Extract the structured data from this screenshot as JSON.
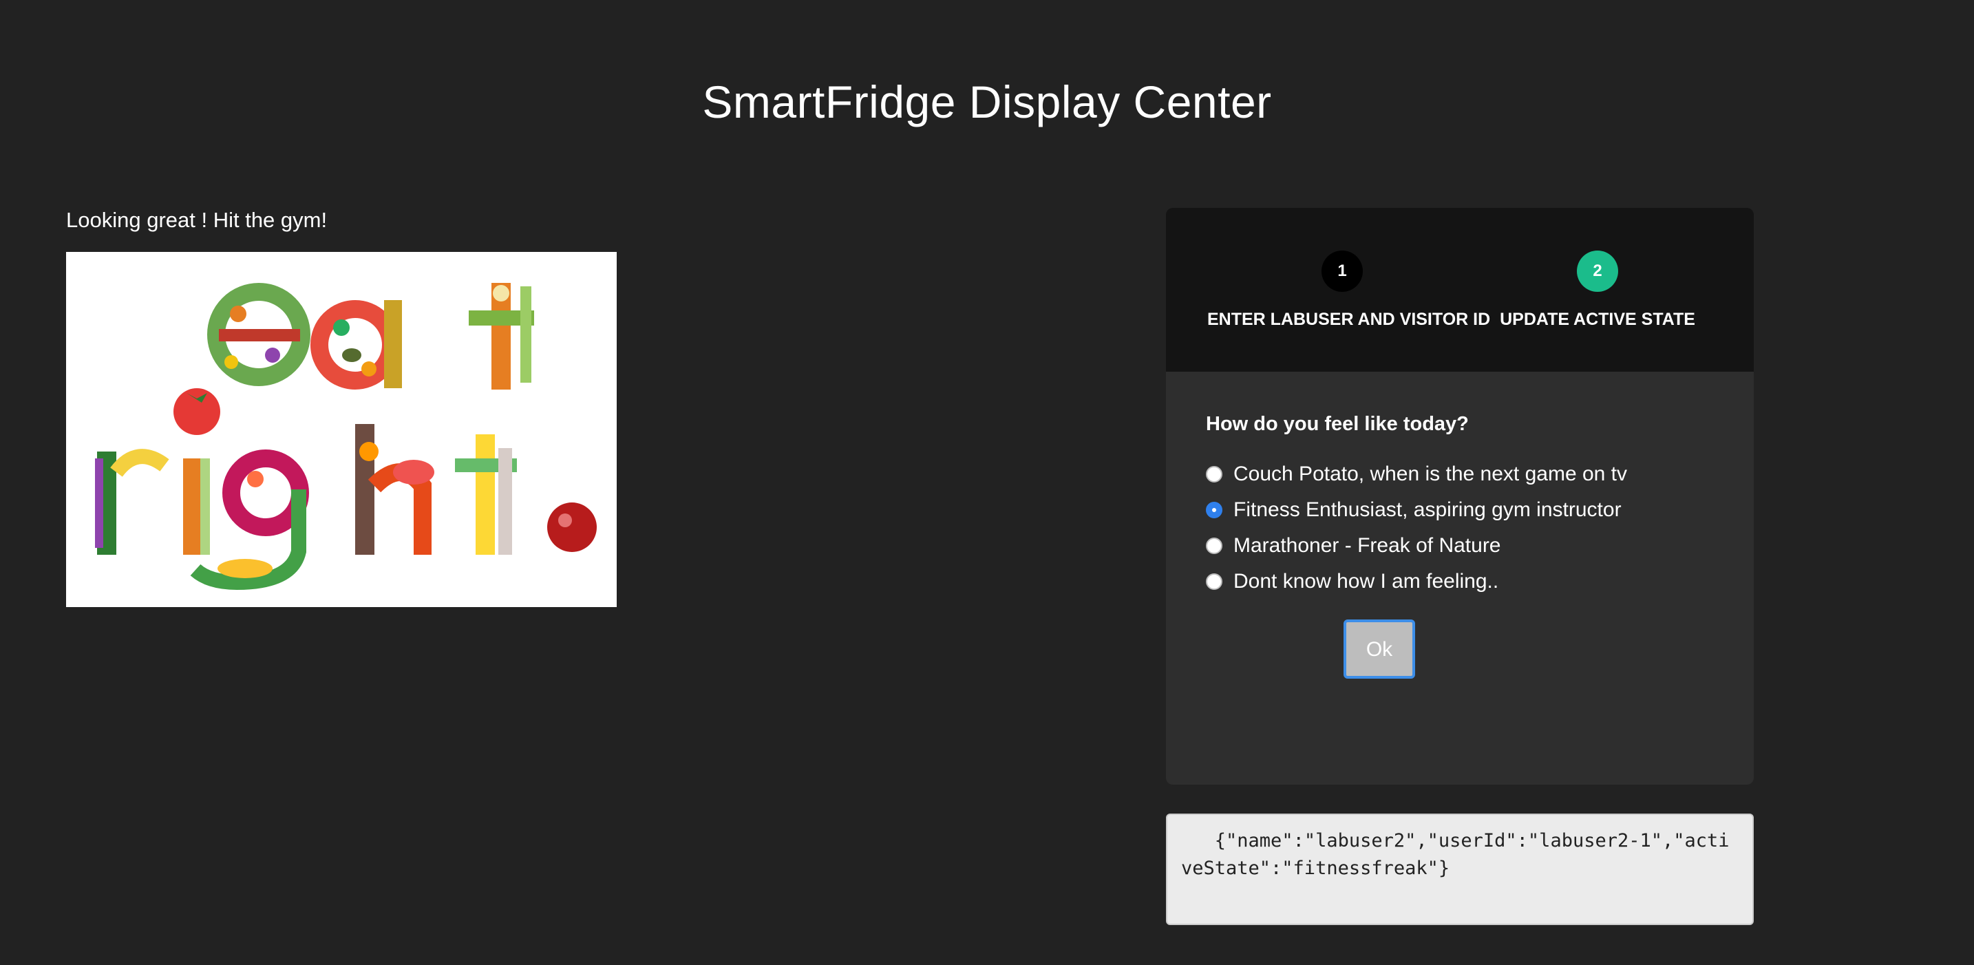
{
  "page": {
    "title": "SmartFridge Display Center",
    "message": "Looking great ! Hit the gym!",
    "image_lettering": "eat right."
  },
  "wizard": {
    "steps": [
      {
        "number": "1",
        "label": "ENTER LABUSER AND VISITOR ID",
        "active": false
      },
      {
        "number": "2",
        "label": "UPDATE ACTIVE STATE",
        "active": true
      }
    ],
    "question": "How do you feel like today?",
    "options": [
      {
        "label": "Couch Potato, when is the next game on tv",
        "selected": false
      },
      {
        "label": "Fitness Enthusiast, aspiring gym instructor",
        "selected": true
      },
      {
        "label": "Marathoner - Freak of Nature",
        "selected": false
      },
      {
        "label": "Dont know how I am feeling..",
        "selected": false
      }
    ],
    "ok_label": "Ok"
  },
  "output": {
    "json_text": "   {\"name\":\"labuser2\",\"userId\":\"labuser2-1\",\"activeState\":\"fitnessfreak\"}"
  },
  "colors": {
    "background": "#222222",
    "panel": "#2e2e2e",
    "panel_header": "#141414",
    "active_step": "#1bbc8b",
    "radio_selected": "#2f80ed"
  }
}
